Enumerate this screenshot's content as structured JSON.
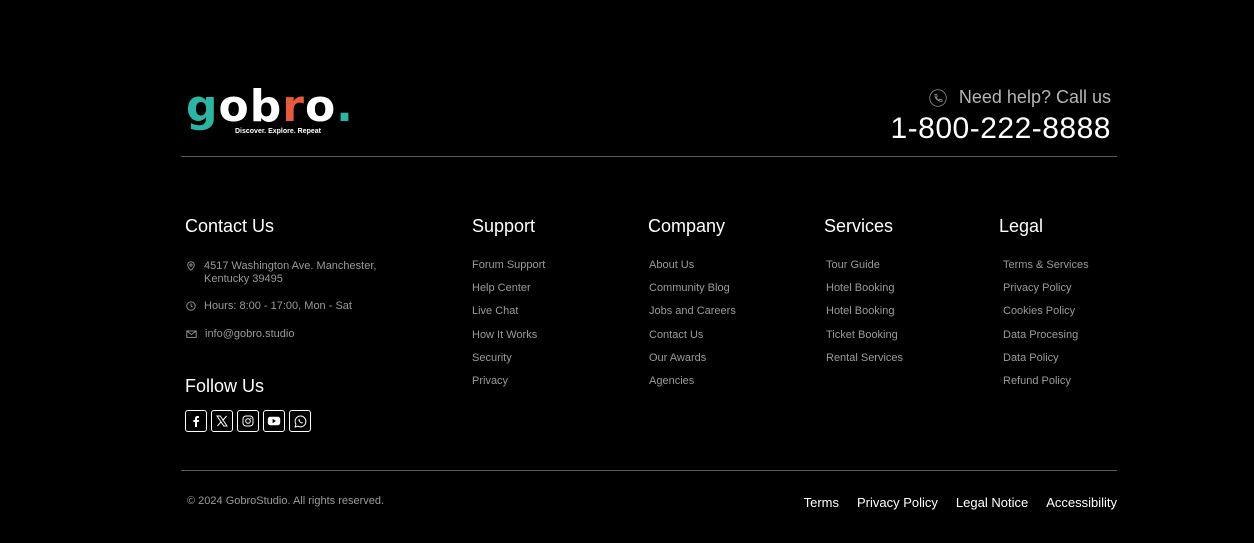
{
  "brand": {
    "logo_letters": [
      "g",
      "o",
      "b",
      "r",
      "o",
      "."
    ],
    "tagline": "Discover. Explore. Repeat",
    "colors": {
      "teal": "#2bb5a4",
      "orange": "#e85a3c",
      "white": "#ffffff"
    }
  },
  "help": {
    "text": "Need help? Call us",
    "phone": "1-800-222-8888",
    "icon": "phone-icon"
  },
  "contact": {
    "title": "Contact Us",
    "address_line1": "4517 Washington Ave. Manchester,",
    "address_line2": "Kentucky 39495",
    "hours": "Hours: 8:00 - 17:00, Mon - Sat",
    "email": "info@gobro.studio"
  },
  "follow": {
    "title": "Follow Us",
    "icons": [
      "facebook-icon",
      "x-icon",
      "instagram-icon",
      "youtube-icon",
      "whatsapp-icon"
    ]
  },
  "columns": {
    "support": {
      "title": "Support",
      "links": [
        "Forum Support",
        "Help Center",
        "Live Chat",
        "How It Works",
        "Security",
        "Privacy"
      ]
    },
    "company": {
      "title": "Company",
      "links": [
        "About Us",
        "Community Blog",
        "Jobs and Careers",
        "Contact Us",
        "Our Awards",
        "Agencies"
      ]
    },
    "services": {
      "title": "Services",
      "links": [
        "Tour Guide",
        "Hotel Booking",
        "Hotel Booking",
        "Ticket Booking",
        "Rental Services"
      ]
    },
    "legal": {
      "title": "Legal",
      "links": [
        "Terms & Services",
        "Privacy Policy",
        "Cookies Policy",
        "Data Procesing",
        "Data Policy",
        "Refund Policy"
      ]
    }
  },
  "footer": {
    "copyright": "© 2024 GobroStudio. All rights reserved.",
    "links": [
      "Terms",
      "Privacy Policy",
      "Legal Notice",
      "Accessibility"
    ]
  }
}
